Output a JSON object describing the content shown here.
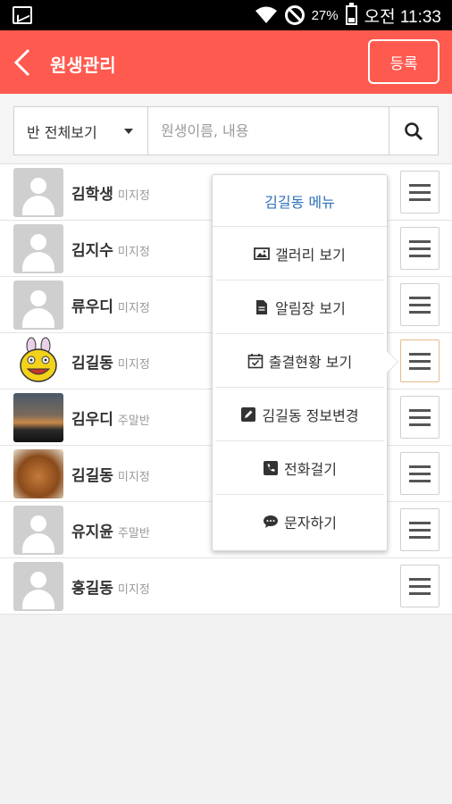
{
  "statusbar": {
    "icons": [
      "gallery-icon",
      "wifi-icon",
      "do-not-disturb-icon",
      "battery-icon"
    ],
    "battery": "27%",
    "time": "오전 11:33"
  },
  "appbar": {
    "title": "원생관리",
    "register_label": "등록",
    "background": "#ff5a4f"
  },
  "search": {
    "filter_value": "반 전체보기",
    "placeholder": "원생이름, 내용"
  },
  "students": [
    {
      "name": "김학생",
      "class": "미지정",
      "avatar": "placeholder"
    },
    {
      "name": "김지수",
      "class": "미지정",
      "avatar": "placeholder"
    },
    {
      "name": "류우디",
      "class": "미지정",
      "avatar": "placeholder"
    },
    {
      "name": "김길동",
      "class": "미지정",
      "avatar": "cartoon-photo"
    },
    {
      "name": "김우디",
      "class": "주말반",
      "avatar": "sunset-photo"
    },
    {
      "name": "김길동",
      "class": "미지정",
      "avatar": "dog-photo"
    },
    {
      "name": "유지윤",
      "class": "주말반",
      "avatar": "placeholder"
    },
    {
      "name": "홍길동",
      "class": "미지정",
      "avatar": "placeholder"
    }
  ],
  "popup": {
    "title": "김길동 메뉴",
    "title_color": "#2c6fb8",
    "items": [
      {
        "label": "갤러리 보기",
        "icon": "image-icon"
      },
      {
        "label": "알림장 보기",
        "icon": "document-icon"
      },
      {
        "label": "출결현황 보기",
        "icon": "calendar-check-icon"
      },
      {
        "label": "김길동 정보변경",
        "icon": "edit-icon"
      },
      {
        "label": "전화걸기",
        "icon": "phone-icon"
      },
      {
        "label": "문자하기",
        "icon": "chat-icon"
      }
    ]
  }
}
